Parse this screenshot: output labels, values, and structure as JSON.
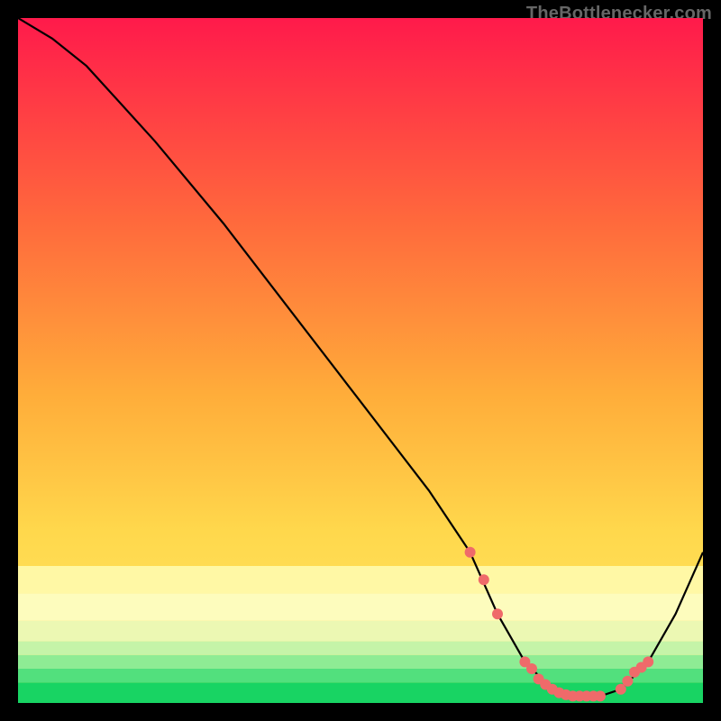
{
  "attribution": "TheBottlenecker.com",
  "chart_data": {
    "type": "line",
    "title": "",
    "xlabel": "",
    "ylabel": "",
    "xlim": [
      0,
      100
    ],
    "ylim": [
      0,
      100
    ],
    "series": [
      {
        "name": "curve",
        "x": [
          0,
          5,
          10,
          20,
          30,
          40,
          50,
          60,
          66,
          70,
          74,
          78,
          82,
          85,
          88,
          92,
          96,
          100
        ],
        "y": [
          100,
          97,
          93,
          82,
          70,
          57,
          44,
          31,
          22,
          13,
          6,
          2,
          1,
          1,
          2,
          6,
          13,
          22
        ]
      }
    ],
    "markers": {
      "name": "dots",
      "x": [
        66,
        68,
        70,
        74,
        75,
        76,
        77,
        78,
        79,
        80,
        81,
        82,
        83,
        84,
        85,
        88,
        89,
        90,
        91,
        92
      ],
      "y": [
        22,
        18,
        13,
        6,
        5,
        3.5,
        2.7,
        2,
        1.5,
        1.2,
        1,
        1,
        1,
        1,
        1,
        2,
        3.2,
        4.5,
        5.2,
        6
      ],
      "color": "#ef6a6a",
      "radius": 6
    },
    "bands": [
      {
        "y0": 0,
        "y1": 3,
        "color": "#18d463"
      },
      {
        "y0": 3,
        "y1": 5,
        "color": "#52e07d"
      },
      {
        "y0": 5,
        "y1": 7,
        "color": "#8eec94"
      },
      {
        "y0": 7,
        "y1": 9,
        "color": "#c5f4a8"
      },
      {
        "y0": 9,
        "y1": 12,
        "color": "#ecf8b3"
      },
      {
        "y0": 12,
        "y1": 16,
        "color": "#fdfcbd"
      },
      {
        "y0": 16,
        "y1": 20,
        "color": "#fff8a5"
      }
    ],
    "gradient_top": "#ff1a4b",
    "gradient_bottom": "#ffe96b"
  }
}
